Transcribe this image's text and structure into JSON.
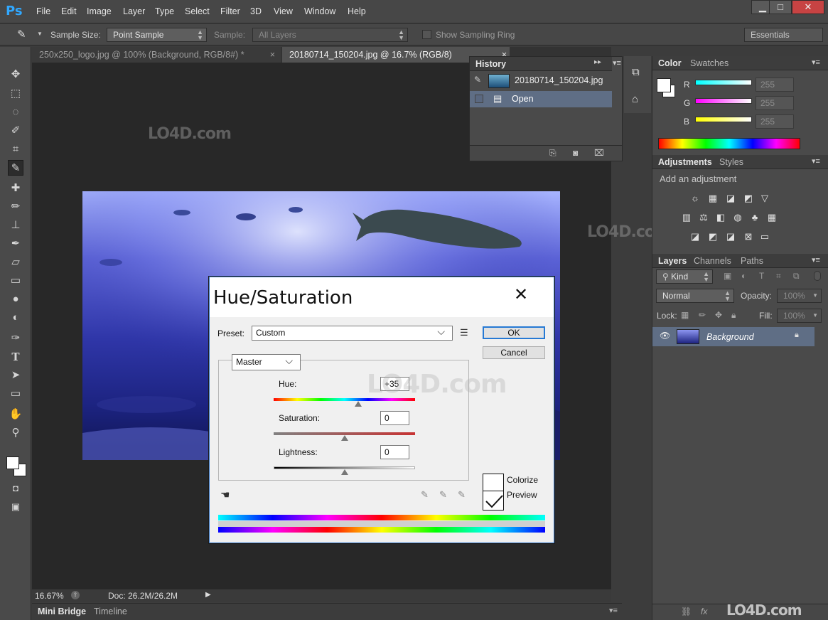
{
  "app": {
    "logo": "Ps"
  },
  "menu": [
    "File",
    "Edit",
    "Image",
    "Layer",
    "Type",
    "Select",
    "Filter",
    "3D",
    "View",
    "Window",
    "Help"
  ],
  "window_controls": {
    "minimize": "▁",
    "maximize": "□",
    "close": "✕"
  },
  "options_bar": {
    "sample_size_label": "Sample Size:",
    "sample_size_value": "Point Sample",
    "sample_label": "Sample:",
    "sample_value": "All Layers",
    "show_ring_label": "Show Sampling Ring",
    "workspace": "Essentials"
  },
  "tabs": [
    {
      "label": "250x250_logo.jpg @ 100% (Background, RGB/8#) *",
      "close": "×"
    },
    {
      "label": "20180714_150204.jpg @ 16.7% (RGB/8)",
      "close": "×"
    }
  ],
  "status": {
    "zoom": "16.67%",
    "doc": "Doc: 26.2M/26.2M"
  },
  "bottom_tabs": {
    "mini_bridge": "Mini Bridge",
    "timeline": "Timeline"
  },
  "history": {
    "tab": "History",
    "snapshot": "20180714_150204.jpg",
    "states": [
      {
        "label": "Open"
      }
    ]
  },
  "color_panel": {
    "tabs": [
      "Color",
      "Swatches"
    ],
    "channels": [
      {
        "label": "R",
        "value": "255"
      },
      {
        "label": "G",
        "value": "255"
      },
      {
        "label": "B",
        "value": "255"
      }
    ]
  },
  "adjustments_panel": {
    "tabs": [
      "Adjustments",
      "Styles"
    ],
    "heading": "Add an adjustment"
  },
  "layers_panel": {
    "tabs": [
      "Layers",
      "Channels",
      "Paths"
    ],
    "filter": "Kind",
    "blend_mode": "Normal",
    "opacity_label": "Opacity:",
    "opacity_value": "100%",
    "lock_label": "Lock:",
    "fill_label": "Fill:",
    "fill_value": "100%",
    "layers": [
      {
        "name": "Background"
      }
    ]
  },
  "watermark": {
    "text": "LO4D.com"
  },
  "dialog": {
    "title": "Hue/Saturation",
    "close": "✕",
    "preset_label": "Preset:",
    "preset_value": "Custom",
    "channel_value": "Master",
    "ok": "OK",
    "cancel": "Cancel",
    "hue_label": "Hue:",
    "hue_value": "+35",
    "saturation_label": "Saturation:",
    "saturation_value": "0",
    "lightness_label": "Lightness:",
    "lightness_value": "0",
    "colorize_label": "Colorize",
    "preview_label": "Preview",
    "colorize_checked": false,
    "preview_checked": true,
    "hue_fraction": 0.6,
    "saturation_fraction": 0.5,
    "lightness_fraction": 0.5
  }
}
